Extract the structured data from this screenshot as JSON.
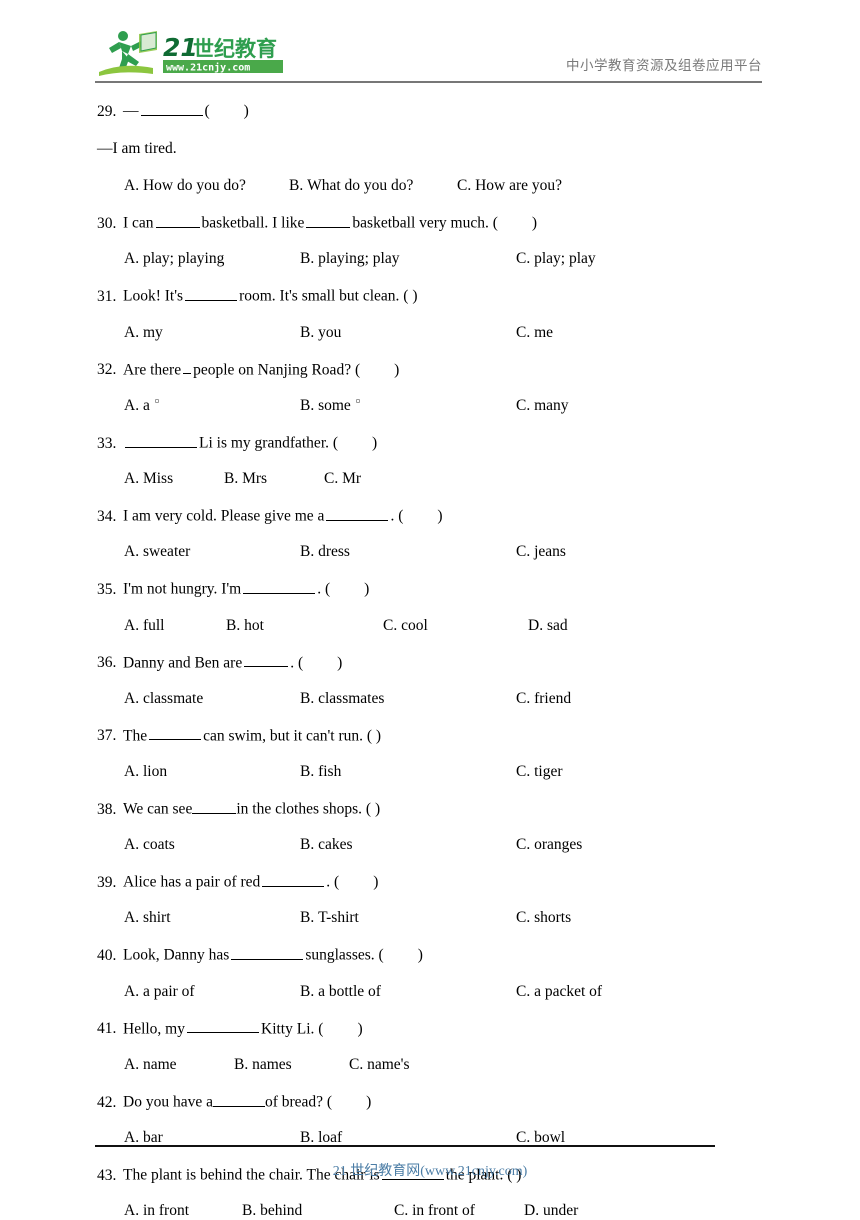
{
  "header": {
    "logo_text_primary": "21世纪教育",
    "logo_text_secondary": "www.21cnjy.com",
    "slogan": "中小学教育资源及组卷应用平台",
    "logo_color": "#2f9e4f",
    "logo_dark_color": "#0f6b33",
    "rule_color": "#777777"
  },
  "footer": {
    "text": "21 世纪教育网(www.21cnjy.com)",
    "color": "#4a7ca5",
    "rule_color": "#111111"
  },
  "questions": [
    {
      "num": "29.",
      "stem_pre": "—",
      "stem_post": "(",
      "stem_close": ")",
      "extra_line": "—I am tired.",
      "options": [
        {
          "label": "A.",
          "text": "How do you do?"
        },
        {
          "label": "B.",
          "text": "What do you do?"
        },
        {
          "label": "C.",
          "text": "How are you?"
        }
      ]
    },
    {
      "num": "30.",
      "stem_a": "I can",
      "stem_b": "basketball. I like",
      "stem_c": "basketball very much. (",
      "stem_close": ")",
      "options": [
        {
          "label": "A.",
          "text": "play; playing"
        },
        {
          "label": "B.",
          "text": "playing; play"
        },
        {
          "label": "C.",
          "text": "play; play"
        }
      ]
    },
    {
      "num": "31.",
      "stem_a": "Look! It's",
      "stem_b": "room. It's small but clean. (  )",
      "options": [
        {
          "label": "A.",
          "text": "my"
        },
        {
          "label": "B.",
          "text": "you"
        },
        {
          "label": "C.",
          "text": "me"
        }
      ]
    },
    {
      "num": "32.",
      "stem_a": "Are there",
      "stem_b": "people on Nanjing Road? (",
      "stem_close": ")",
      "options": [
        {
          "label": "A.",
          "text": "a",
          "artifact": true
        },
        {
          "label": "B.",
          "text": "some",
          "artifact": true
        },
        {
          "label": "C.",
          "text": "many"
        }
      ]
    },
    {
      "num": "33.",
      "stem_a": "",
      "stem_b": "Li is my grandfather. (",
      "stem_close": ")",
      "options": [
        {
          "label": "A.",
          "text": "Miss"
        },
        {
          "label": "B.",
          "text": "Mrs"
        },
        {
          "label": "C.",
          "text": "Mr"
        }
      ]
    },
    {
      "num": "34.",
      "stem_a": "I am very cold. Please give me a",
      "stem_b": ". (",
      "stem_close": ")",
      "options": [
        {
          "label": "A.",
          "text": "sweater"
        },
        {
          "label": "B.",
          "text": "dress"
        },
        {
          "label": "C.",
          "text": "jeans"
        }
      ]
    },
    {
      "num": "35.",
      "stem_a": "I'm not hungry. I'm",
      "stem_b": ".  (",
      "stem_close": ")",
      "options": [
        {
          "label": "A.",
          "text": "full"
        },
        {
          "label": "B.",
          "text": "hot"
        },
        {
          "label": "C.",
          "text": "cool"
        },
        {
          "label": "D.",
          "text": "sad"
        }
      ]
    },
    {
      "num": "36.",
      "stem_a": "Danny and Ben are",
      "stem_b": ". (",
      "stem_close": ")",
      "options": [
        {
          "label": "A.",
          "text": "classmate"
        },
        {
          "label": "B.",
          "text": "classmates"
        },
        {
          "label": "C.",
          "text": "friend"
        }
      ]
    },
    {
      "num": "37.",
      "stem_a": "The",
      "stem_b": "can swim, but it can't run. (  )",
      "options": [
        {
          "label": "A.",
          "text": "lion"
        },
        {
          "label": "B.",
          "text": "fish"
        },
        {
          "label": "C.",
          "text": "tiger"
        }
      ]
    },
    {
      "num": "38.",
      "stem_a": "We can see",
      "stem_b": "in the clothes shops.  (  )",
      "options": [
        {
          "label": "A.",
          "text": "coats"
        },
        {
          "label": "B.",
          "text": "cakes"
        },
        {
          "label": "C.",
          "text": "oranges"
        }
      ]
    },
    {
      "num": "39.",
      "stem_a": "Alice has a pair of red",
      "stem_b": ". (",
      "stem_close": ")",
      "options": [
        {
          "label": "A.",
          "text": "shirt"
        },
        {
          "label": "B.",
          "text": "T-shirt"
        },
        {
          "label": "C.",
          "text": "shorts"
        }
      ]
    },
    {
      "num": "40.",
      "stem_a": "Look, Danny has",
      "stem_b": "sunglasses. (",
      "stem_close": ")",
      "options": [
        {
          "label": "A.",
          "text": "a pair of"
        },
        {
          "label": "B.",
          "text": "a bottle of"
        },
        {
          "label": "C.",
          "text": "a packet of"
        }
      ]
    },
    {
      "num": "41.",
      "stem_a": "Hello, my",
      "stem_b": "Kitty Li. (",
      "stem_close": ")",
      "options": [
        {
          "label": "A.",
          "text": "name"
        },
        {
          "label": "B.",
          "text": "names"
        },
        {
          "label": "C.",
          "text": "name's"
        }
      ]
    },
    {
      "num": "42.",
      "stem_a": "Do you have a",
      "stem_b": "of bread? (",
      "stem_close": ")",
      "options": [
        {
          "label": "A.",
          "text": "bar"
        },
        {
          "label": "B.",
          "text": "loaf"
        },
        {
          "label": "C.",
          "text": "bowl"
        }
      ]
    },
    {
      "num": "43.",
      "stem_a": "The plant is behind the chair. The chair is",
      "stem_b": "the plant. (  )",
      "options": [
        {
          "label": "A.",
          "text": "in front"
        },
        {
          "label": "B.",
          "text": "behind"
        },
        {
          "label": "C.",
          "text": "in front of"
        },
        {
          "label": "D.",
          "text": "under"
        }
      ]
    }
  ]
}
